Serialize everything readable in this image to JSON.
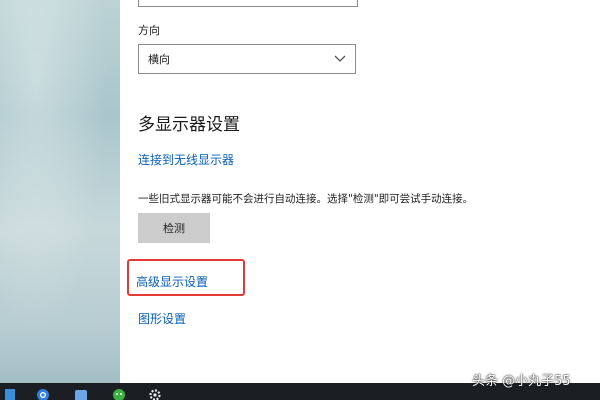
{
  "display_settings": {
    "orientation_label": "方向",
    "orientation_value": "横向",
    "multi_display_title": "多显示器设置",
    "connect_wireless_link": "连接到无线显示器",
    "legacy_description": "一些旧式显示器可能不会进行自动连接。选择\"检测\"即可尝试手动连接。",
    "detect_button": "检测",
    "advanced_link": "高级显示设置",
    "graphics_link": "图形设置"
  },
  "watermark": {
    "text": "头条 @小丸子55"
  },
  "colors": {
    "link": "#0a5fb8",
    "highlight": "#e53935",
    "button_bg": "#cccccc",
    "taskbar": "#1b1f24"
  },
  "icons": {
    "dropdown": "chevron-down-icon",
    "taskbar": [
      "blue-browser-icon",
      "app-icon",
      "green-chat-icon",
      "settings-gear-icon"
    ]
  }
}
